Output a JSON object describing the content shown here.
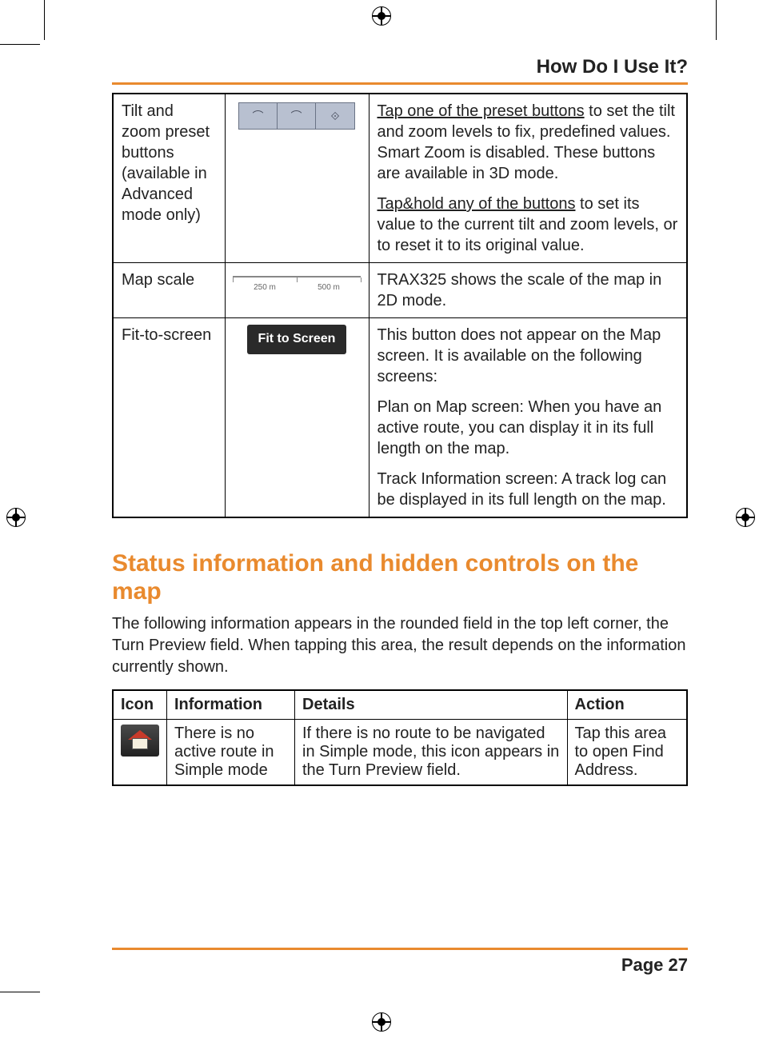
{
  "header": {
    "section_title": "How Do I Use It?"
  },
  "table1": {
    "rows": [
      {
        "label": "Tilt and zoom preset buttons (available in Advanced mode only)",
        "desc_parts": {
          "p1_u": "Tap one of the preset buttons",
          "p1_rest": " to set the tilt and zoom levels to fix, predefined values. Smart Zoom is disabled. These buttons are available in 3D mode.",
          "p2_u": "Tap&hold any of the buttons",
          "p2_rest": " to set its value to the current tilt and zoom levels, or to reset it to its original value."
        }
      },
      {
        "label": "Map scale",
        "scale": {
          "l1": "250 m",
          "l2": "500 m"
        },
        "desc": "TRAX325 shows the scale of the map in 2D mode."
      },
      {
        "label": "Fit-to-screen",
        "button_text": "Fit to Screen",
        "desc_parts": {
          "p1": "This button does not appear on the Map screen. It is available on the following screens:",
          "p2": "Plan on Map screen: When you have an active route, you can display it in its full length on the map.",
          "p3": "Track Information screen: A track log can be displayed in its full length on the map."
        }
      }
    ]
  },
  "section2": {
    "heading": "Status information and hidden controls on the map",
    "intro": "The following information appears in the rounded field in the top left corner, the Turn Preview field. When tapping this area, the result depends on the information currently shown."
  },
  "table2": {
    "headers": {
      "c1": "Icon",
      "c2": "Information",
      "c3": "Details",
      "c4": "Action"
    },
    "row": {
      "info": "There is no active route in Simple mode",
      "details": "If there is no route to be navigated in Simple mode, this icon appears in the Turn Preview field.",
      "action": "Tap this area to open Find Address."
    }
  },
  "footer": {
    "page_label": "Page 27"
  }
}
